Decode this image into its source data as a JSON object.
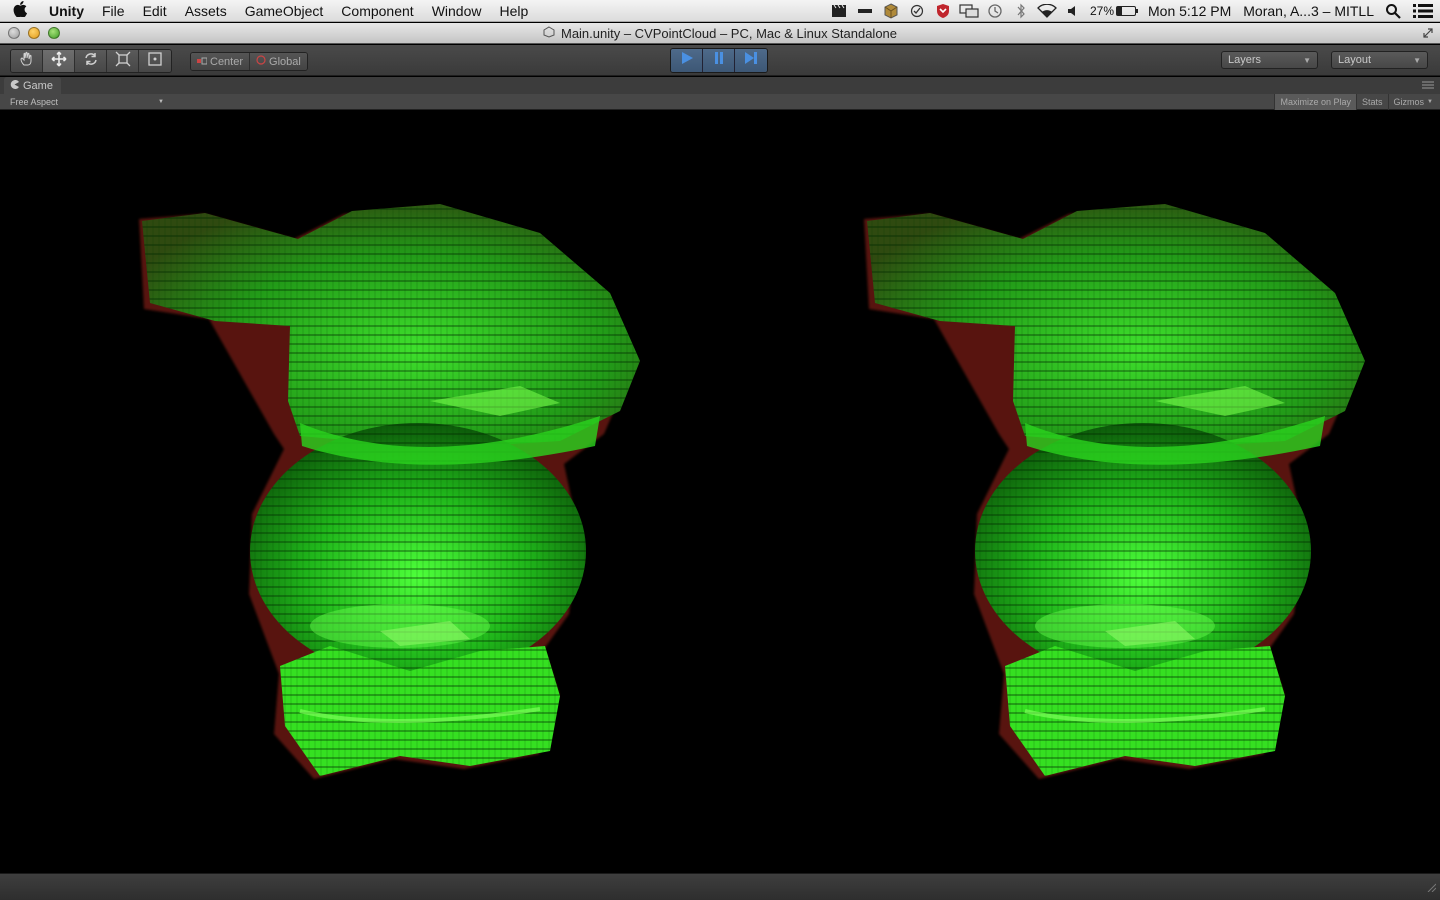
{
  "menubar": {
    "app": "Unity",
    "items": [
      "File",
      "Edit",
      "Assets",
      "GameObject",
      "Component",
      "Window",
      "Help"
    ],
    "battery": "27%",
    "battery_level": 0.27,
    "clock": "Mon 5:12 PM",
    "user": "Moran, A...3 – MITLL"
  },
  "window": {
    "title": "Main.unity – CVPointCloud – PC, Mac & Linux Standalone"
  },
  "toolbar": {
    "center_label": "Center",
    "global_label": "Global",
    "layers_label": "Layers",
    "layout_label": "Layout"
  },
  "game_panel": {
    "tab_label": "Game",
    "aspect_label": "Free Aspect",
    "maximize_label": "Maximize on Play",
    "stats_label": "Stats",
    "gizmos_label": "Gizmos"
  },
  "colors": {
    "model_green": "#33ff33",
    "anaglyph_red": "#c0392b",
    "play_blue": "#4a90e2"
  }
}
